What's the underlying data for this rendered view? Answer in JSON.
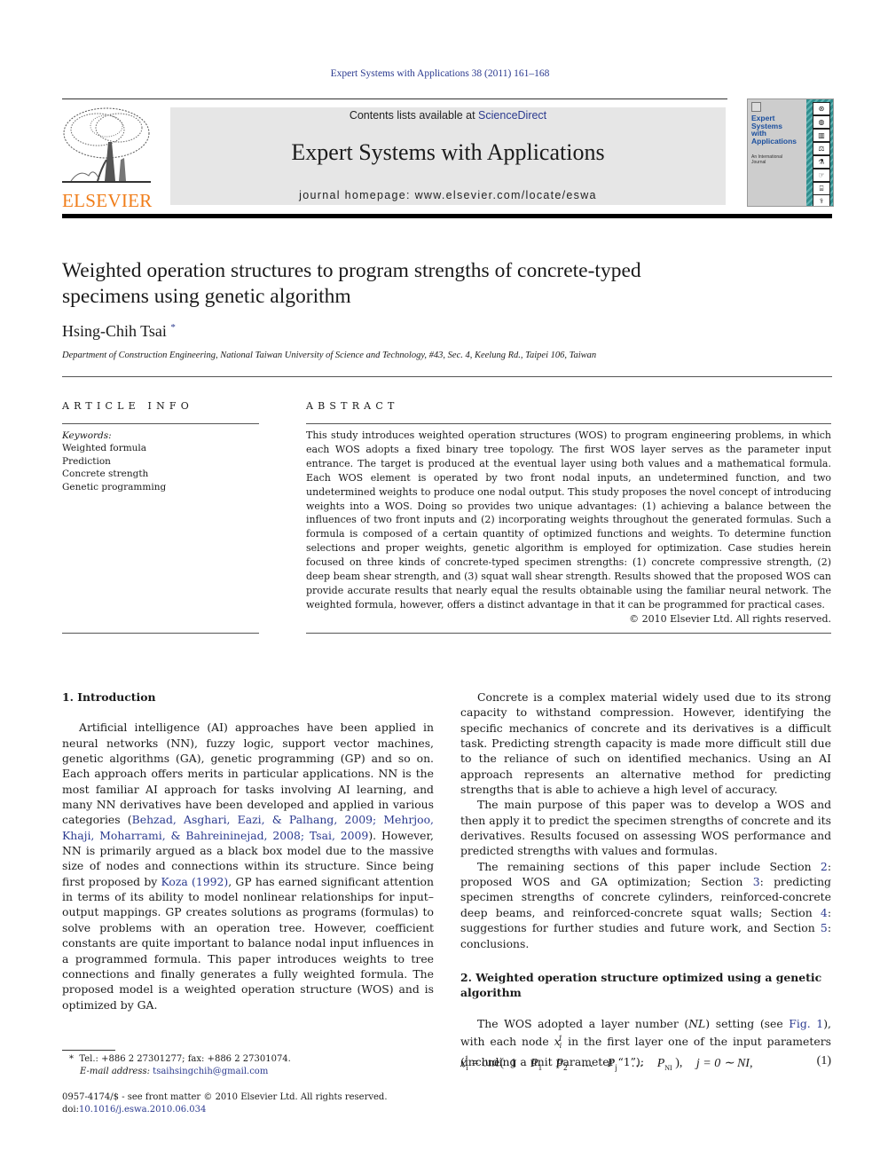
{
  "header": {
    "running_head": "Expert Systems with Applications 38 (2011) 161–168",
    "publisher_logo_text": "ELSEVIER",
    "contents_prefix": "Contents lists available at ",
    "contents_link": "ScienceDirect",
    "journal_title": "Expert Systems with Applications",
    "homepage": "journal homepage: www.elsevier.com/locate/eswa",
    "cover": {
      "title_lines": [
        "Expert",
        "Systems",
        "with",
        "Applications"
      ],
      "subtitle_lines": [
        "An International",
        "Journal"
      ],
      "strip_color": "#2f8d8d",
      "title_color": "#1b4f9e"
    },
    "brand_color": "#f07d19",
    "link_color": "#2b3a8f"
  },
  "article": {
    "title_line1": "Weighted operation structures to program strengths of concrete-typed",
    "title_line2": "specimens using genetic algorithm",
    "author": "Hsing-Chih Tsai",
    "author_mark": "*",
    "affiliation": "Department of Construction Engineering, National Taiwan University of Science and Technology, #43, Sec. 4, Keelung Rd., Taipei 106, Taiwan"
  },
  "article_info": {
    "heading": "ARTICLE INFO",
    "keywords_label": "Keywords:",
    "keywords": [
      "Weighted formula",
      "Prediction",
      "Concrete strength",
      "Genetic programming"
    ]
  },
  "abstract": {
    "heading": "ABSTRACT",
    "text": "This study introduces weighted operation structures (WOS) to program engineering problems, in which each WOS adopts a fixed binary tree topology. The first WOS layer serves as the parameter input entrance. The target is produced at the eventual layer using both values and a mathematical formula. Each WOS element is operated by two front nodal inputs, an undetermined function, and two undetermined weights to produce one nodal output. This study proposes the novel concept of introducing weights into a WOS. Doing so provides two unique advantages: (1) achieving a balance between the influences of two front inputs and (2) incorporating weights throughout the generated formulas. Such a formula is composed of a certain quantity of optimized functions and weights. To determine function selections and proper weights, genetic algorithm is employed for optimization. Case studies herein focused on three kinds of concrete-typed specimen strengths: (1) concrete compressive strength, (2) deep beam shear strength, and (3) squat wall shear strength. Results showed that the proposed WOS can provide accurate results that nearly equal the results obtainable using the familiar neural network. The weighted formula, however, offers a distinct advantage in that it can be programmed for practical cases.",
    "copyright": "© 2010 Elsevier Ltd. All rights reserved."
  },
  "body": {
    "section1_heading": "1. Introduction",
    "intro_p1_before": "Artificial intelligence (AI) approaches have been applied in neural networks (NN), fuzzy logic, support vector machines, genetic algorithms (GA), genetic programming (GP) and so on. Each approach offers merits in particular applications. NN is the most familiar AI approach for tasks involving AI learning, and many NN derivatives have been developed and applied in various categories (",
    "intro_p1_cite1": "Behzad, Asghari, Eazi, & Palhang, 2009; Mehrjoo, Khaji, Moharrami, & Bahreininejad, 2008; Tsai, 2009",
    "intro_p1_mid": "). However, NN is primarily argued as a black box model due to the massive size of nodes and connections within its structure. Since being first proposed by ",
    "intro_p1_cite2": "Koza (1992)",
    "intro_p1_after": ", GP has earned significant attention in terms of its ability to model nonlinear relationships for input–output mappings. GP creates solutions as programs (formulas) to solve problems with an operation tree. However, coefficient constants are quite important to balance nodal input influences in a programmed formula. This paper introduces weights to tree connections and finally generates a fully weighted formula. The proposed model is a weighted operation structure (WOS) and is optimized by GA.",
    "right_p1": "Concrete is a complex material widely used due to its strong capacity to withstand compression. However, identifying the specific mechanics of concrete and its derivatives is a difficult task. Predicting strength capacity is made more difficult still due to the reliance of such on identified mechanics. Using an AI approach represents an alternative method for predicting strengths that is able to achieve a high level of accuracy.",
    "right_p2": "The main purpose of this paper was to develop a WOS and then apply it to predict the specimen strengths of concrete and its derivatives. Results focused on assessing WOS performance and predicted strengths with values and formulas.",
    "right_p3_a": "The remaining sections of this paper include Section ",
    "right_p3_s2": "2",
    "right_p3_b": ": proposed WOS and GA optimization; Section ",
    "right_p3_s3": "3",
    "right_p3_c": ": predicting specimen strengths of concrete cylinders, reinforced-concrete deep beams, and reinforced-concrete squat walls; Section ",
    "right_p3_s4": "4",
    "right_p3_d": ": suggestions for further studies and future work, and Section ",
    "right_p3_s5": "5",
    "right_p3_e": ": conclusions.",
    "section2_heading": "2. Weighted operation structure optimized using a genetic algorithm",
    "sec2_p1_a": "The WOS adopted a layer number (",
    "sec2_p1_nl": "NL",
    "sec2_p1_b": ") setting (see ",
    "sec2_p1_fig": "Fig. 1",
    "sec2_p1_c": "), with each node ",
    "sec2_p1_d": " in the first layer one of the input parameters (including a unit parameter “1”):",
    "equation": {
      "lhs": "x",
      "lhs_sub": "i",
      "lhs_sup": "1",
      "func": "= one(",
      "terms": [
        "1",
        "P",
        "P",
        "…",
        "P",
        "…",
        "P"
      ],
      "term_subs": [
        "",
        "1",
        "2",
        "",
        "j",
        "",
        "NI"
      ],
      "close": "),",
      "range": "j = 0 ∼ NI,",
      "number": "(1)"
    }
  },
  "footnotes": {
    "contact": "Tel.: +886 2 27301277; fax: +886 2 27301074.",
    "email_label": "E-mail address:",
    "email": "tsaihsingchih@gmail.com",
    "issn_line": "0957-4174/$ - see front matter © 2010 Elsevier Ltd. All rights reserved.",
    "doi_label": "doi:",
    "doi": "10.1016/j.eswa.2010.06.034"
  }
}
